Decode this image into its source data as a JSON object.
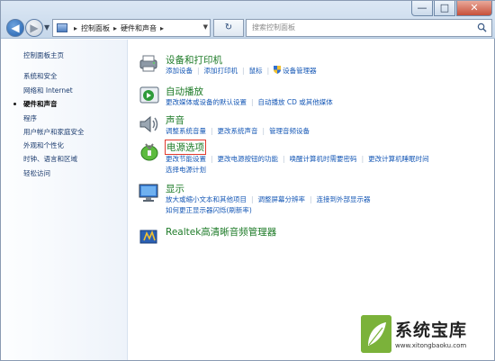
{
  "window": {
    "controls": {
      "minimize": "—",
      "maximize": "□",
      "close": "✕"
    }
  },
  "nav": {
    "back_icon": "back-arrow-icon",
    "forward_icon": "forward-arrow-icon"
  },
  "address": {
    "crumbs": [
      "控制面板",
      "硬件和声音"
    ],
    "separator": "▸"
  },
  "refresh": {
    "symbol": "↻"
  },
  "search": {
    "placeholder": "搜索控制面板"
  },
  "sidebar": {
    "items": [
      {
        "label": "控制面板主页",
        "active": false
      },
      {
        "label": "系统和安全",
        "active": false
      },
      {
        "label": "网络和 Internet",
        "active": false
      },
      {
        "label": "硬件和声音",
        "active": true
      },
      {
        "label": "程序",
        "active": false
      },
      {
        "label": "用户帐户和家庭安全",
        "active": false
      },
      {
        "label": "外观和个性化",
        "active": false
      },
      {
        "label": "时钟、语言和区域",
        "active": false
      },
      {
        "label": "轻松访问",
        "active": false
      }
    ]
  },
  "categories": [
    {
      "title": "设备和打印机",
      "icon": "printer-icon",
      "lines": [
        [
          "添加设备",
          "添加打印机",
          "鼠标",
          "设备管理器"
        ]
      ]
    },
    {
      "title": "自动播放",
      "icon": "autoplay-icon",
      "lines": [
        [
          "更改媒体或设备的默认设置",
          "自动播放 CD 或其他媒体"
        ]
      ]
    },
    {
      "title": "声音",
      "icon": "speaker-icon",
      "lines": [
        [
          "调整系统音量",
          "更改系统声音",
          "管理音频设备"
        ]
      ]
    },
    {
      "title": "电源选项",
      "icon": "power-options-icon",
      "lines": [
        [
          "更改节能设置",
          "更改电源按钮的功能",
          "唤醒计算机时需要密码",
          "更改计算机睡眠时间"
        ],
        [
          "选择电源计划"
        ]
      ]
    },
    {
      "title": "显示",
      "icon": "display-icon",
      "lines": [
        [
          "放大或缩小文本和其他项目",
          "调整屏幕分辨率",
          "连接到外部显示器"
        ],
        [
          "如何更正显示器闪烁(刷新率)"
        ]
      ]
    },
    {
      "title": "Realtek高清晰音频管理器",
      "icon": "realtek-audio-icon",
      "lines": []
    }
  ],
  "watermark": {
    "title": "系统宝库",
    "url": "www.xitongbaoku.com"
  },
  "colors": {
    "category_title": "#1e7b28",
    "link": "#1658b6",
    "highlight_box": "#e03a2e"
  }
}
